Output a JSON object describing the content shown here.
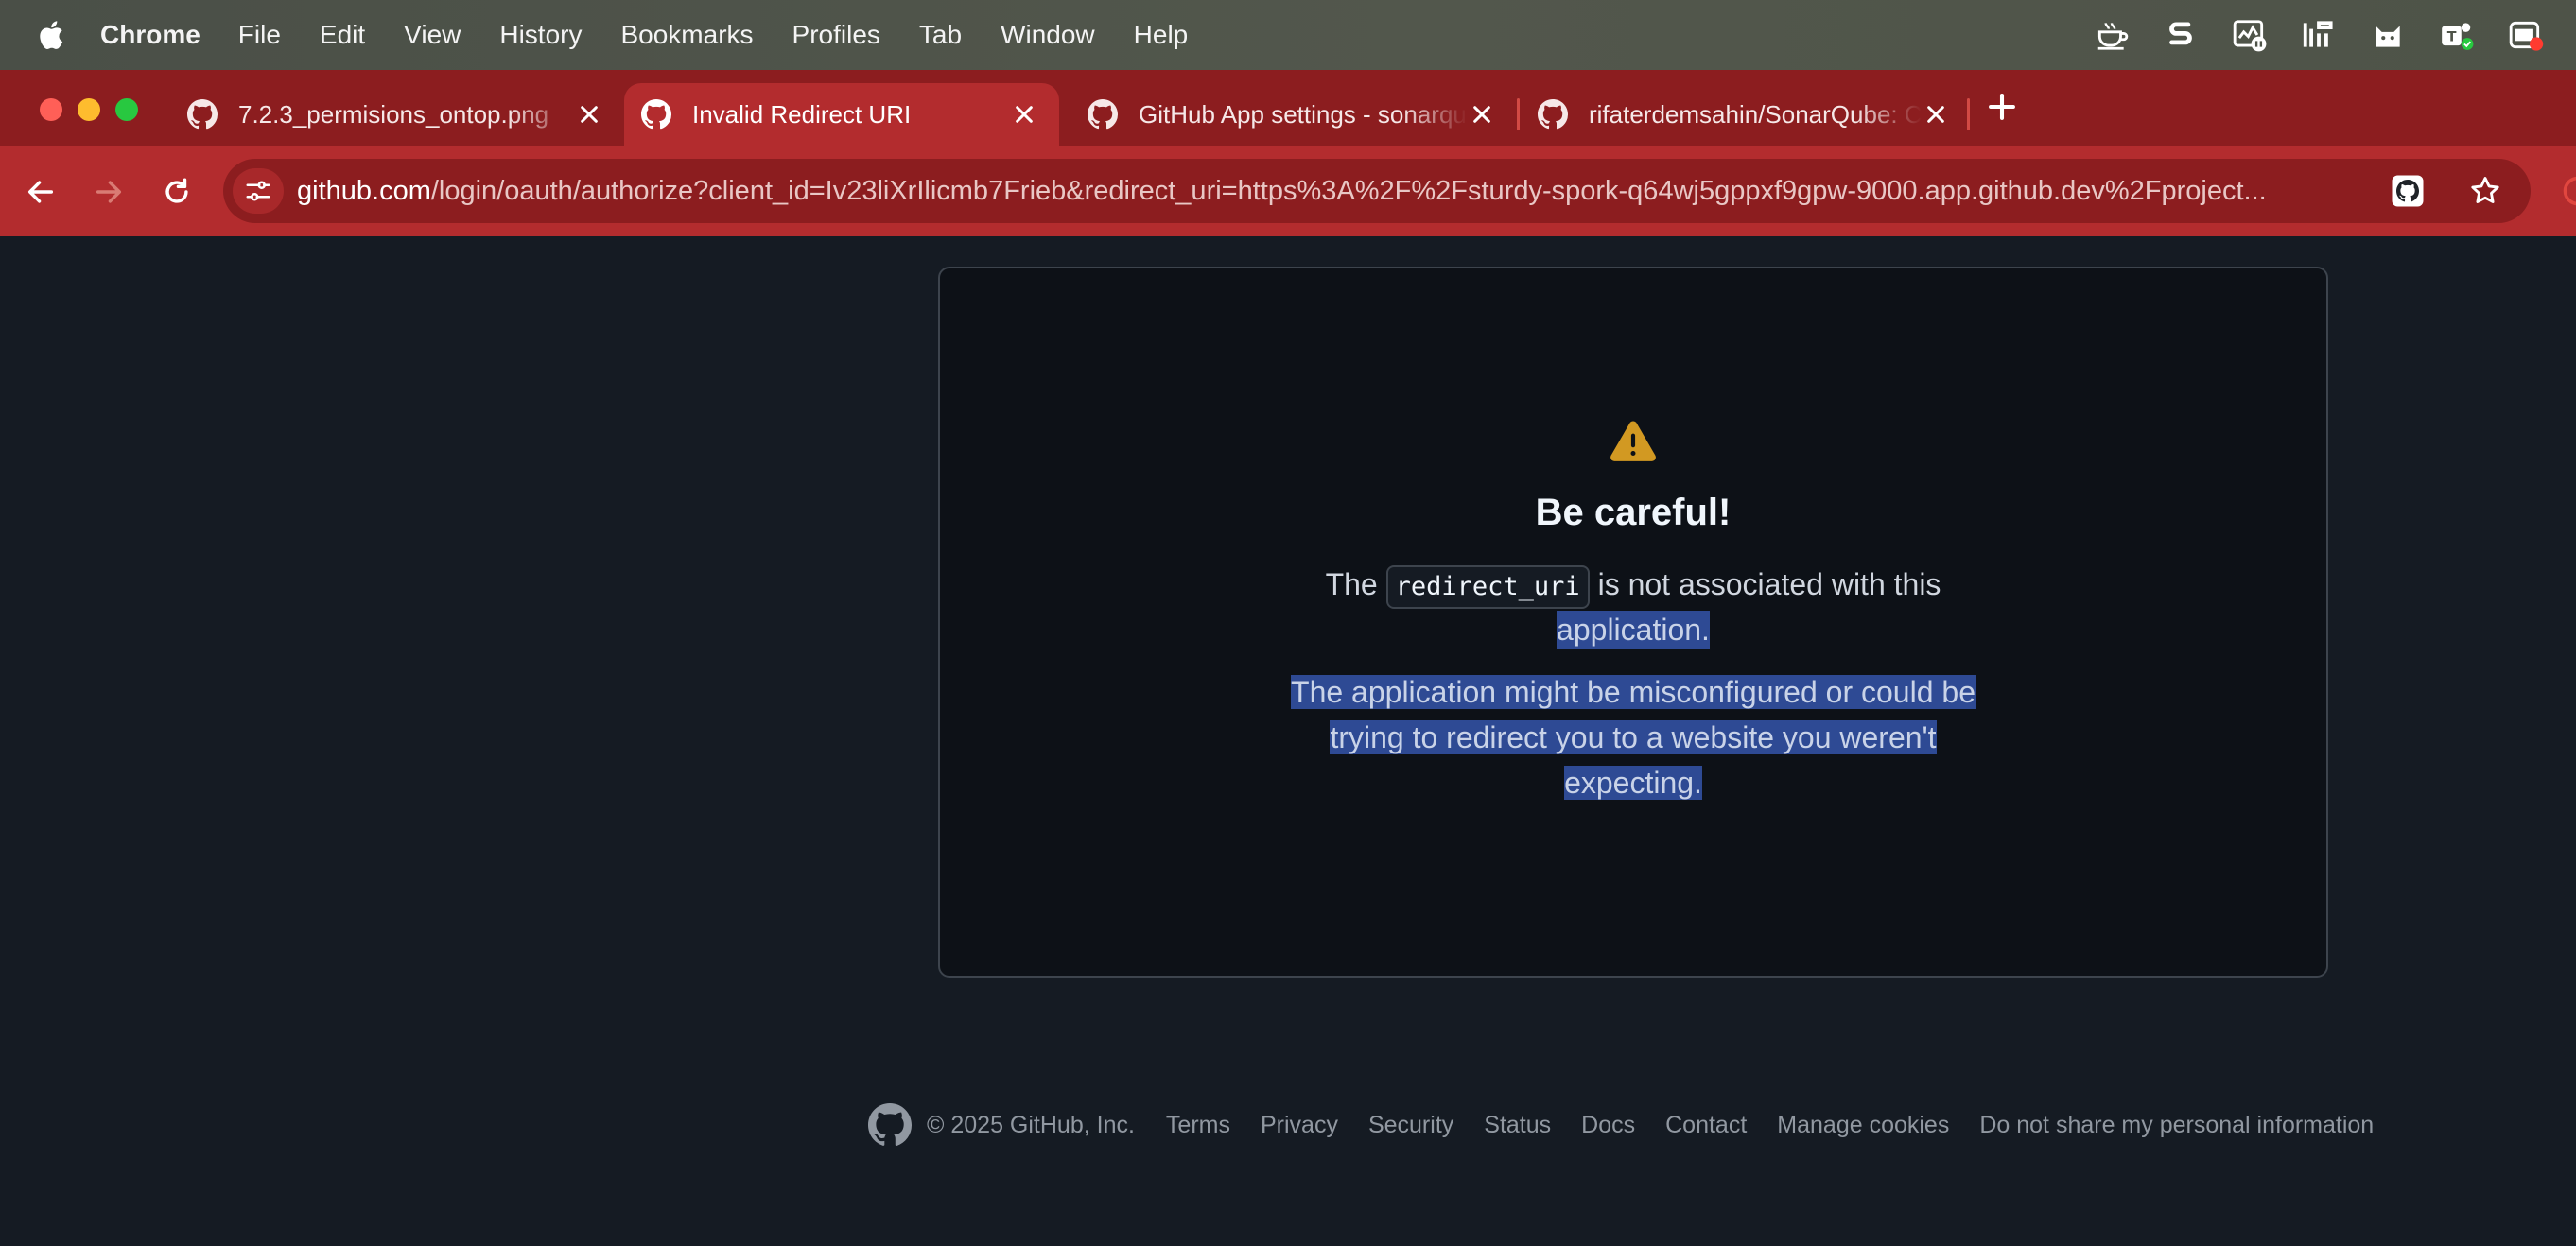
{
  "menubar": {
    "items": [
      "Chrome",
      "File",
      "Edit",
      "View",
      "History",
      "Bookmarks",
      "Profiles",
      "Tab",
      "Window",
      "Help"
    ]
  },
  "tabs": [
    {
      "title": "7.2.3_permisions_ontop.png",
      "active": false
    },
    {
      "title": "Invalid Redirect URI",
      "active": true
    },
    {
      "title": "GitHub App settings - sonarqube",
      "active": false
    },
    {
      "title": "rifaterdemsahin/SonarQube: Code",
      "active": false
    }
  ],
  "omnibox": {
    "domain": "github.com",
    "path": "/login/oauth/authorize?client_id=Iv23liXrIlicmb7Frieb&redirect_uri=https%3A%2F%2Fsturdy-spork-q64wj5gppxf9gpw-9000.app.github.dev%2Fproject..."
  },
  "notice": {
    "title": "Be careful!",
    "line1_prefix": "The",
    "code": "redirect_uri",
    "line1_suffix": "is not associated with this",
    "line2": "application.",
    "para2_a": "The application might be misconfigured or could be",
    "para2_b": "trying to redirect you to a website you weren't",
    "para2_c": "expecting."
  },
  "footer": {
    "copyright": "© 2025 GitHub, Inc.",
    "links": [
      "Terms",
      "Privacy",
      "Security",
      "Status",
      "Docs",
      "Contact",
      "Manage cookies",
      "Do not share my personal information"
    ]
  },
  "colors": {
    "accent": "#b32c2e",
    "tabstrip": "#8c1d1f",
    "page_bg": "#151b23",
    "card_bg": "#0d1117",
    "warning": "#d29922",
    "selection": "#2e4a94"
  }
}
